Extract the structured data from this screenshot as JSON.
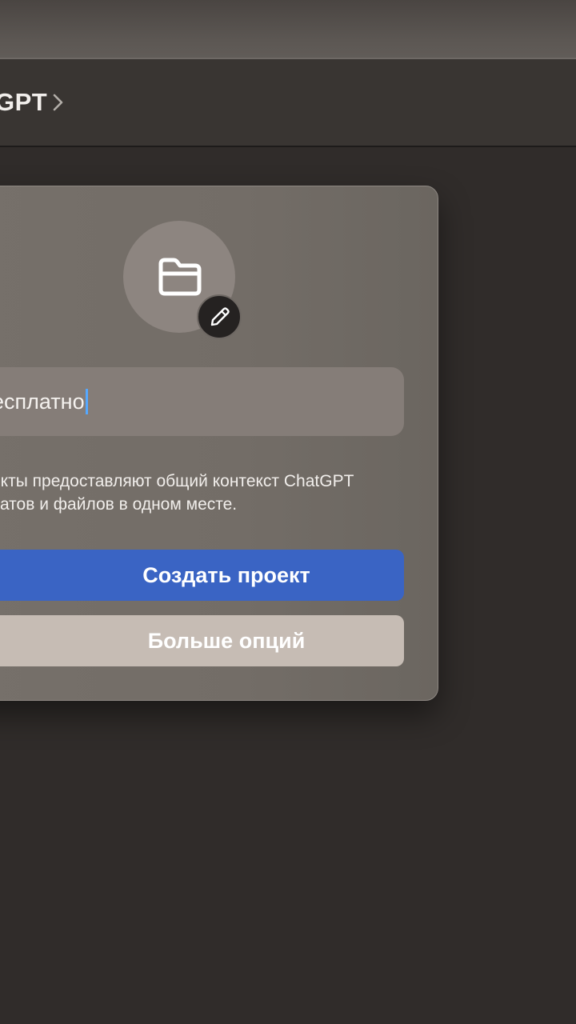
{
  "header": {
    "title": "GPT"
  },
  "dialog": {
    "project_name": "есплатно",
    "description": "екты предоставляют общий контекст ChatGPT\nчатов и файлов в одном месте.",
    "create_button_label": "Создать проект",
    "more_options_label": "Больше опций"
  },
  "icons": {
    "avatar": "folder-icon",
    "edit": "pencil-icon",
    "header": "chevron-right-icon"
  },
  "colors": {
    "primary": "#3a64c4",
    "secondary": "#c6bcb4",
    "caret": "#55a8ff"
  }
}
